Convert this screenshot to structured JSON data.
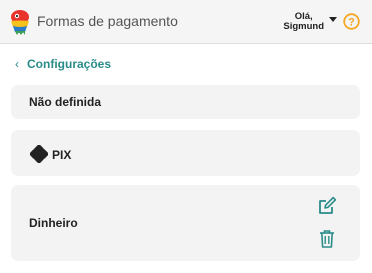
{
  "header": {
    "app_title": "Formas de pagamento",
    "greeting_line1": "Olá,",
    "greeting_line2": "Sigmund",
    "help_icon": "question-circle-icon",
    "caret_icon": "caret-down-icon"
  },
  "nav": {
    "back_label": "Configurações"
  },
  "payment_methods": [
    {
      "label": "Não definida"
    },
    {
      "label": "PIX",
      "icon": "pix-icon"
    },
    {
      "label": "Dinheiro",
      "actions": [
        "edit-icon",
        "trash-icon"
      ]
    }
  ],
  "colors": {
    "accent": "#2a8c8a",
    "help_orange": "#f5a623",
    "card_bg": "#f3f3f3"
  }
}
